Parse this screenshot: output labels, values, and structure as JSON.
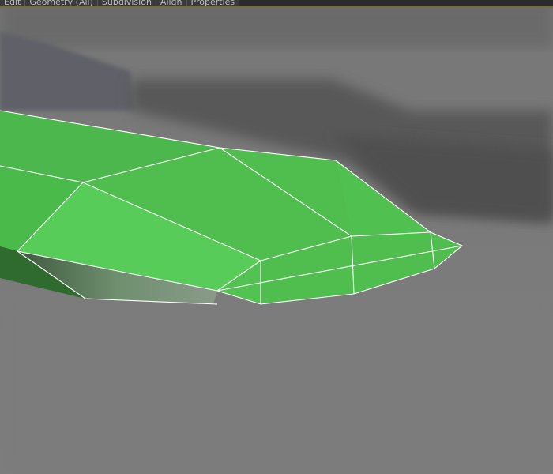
{
  "toolbar": {
    "tabs": [
      {
        "label": "Edit"
      },
      {
        "label": "Geometry (All)"
      },
      {
        "label": "Subdivision"
      },
      {
        "label": "Align"
      },
      {
        "label": "Properties"
      }
    ]
  },
  "colors": {
    "background": "#7a7a7a",
    "toolbar": "#2b2b2b",
    "mesh_light": "#58cc58",
    "mesh_mid": "#4ab74a",
    "mesh_dark": "#2d6e2d",
    "wireframe": "#ffffff"
  }
}
